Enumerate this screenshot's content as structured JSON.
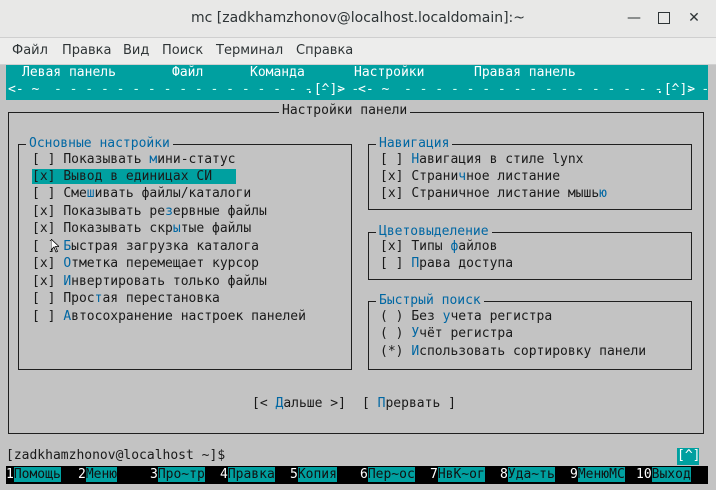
{
  "window": {
    "title": "mc [zadkhamzhonov@localhost.localdomain]:~",
    "minimize": "—",
    "close": "✕"
  },
  "menubar": [
    "Файл",
    "Правка",
    "Вид",
    "Поиск",
    "Терминал",
    "Справка"
  ],
  "mc_menu": [
    "Левая панель",
    "Файл",
    "Команда",
    "Настройки",
    "Правая панель"
  ],
  "panel_bar": {
    "left": "<- ~ ",
    "left_tail": ".[^]>",
    "right": "<- ~ ",
    "right_tail": ".[^]>"
  },
  "dialog": {
    "title": "Настройки панели",
    "main_group": {
      "title": "Основные настройки",
      "items": [
        {
          "mark": "[ ]",
          "pre": "Показывать ",
          "hot": "м",
          "post": "ини-статус"
        },
        {
          "mark": "[x]",
          "pre": "Вывод в единицах СИ",
          "hot": "",
          "post": ""
        },
        {
          "mark": "[ ]",
          "pre": "Сме",
          "hot": "ш",
          "post": "ивать файлы/каталоги"
        },
        {
          "mark": "[x]",
          "pre": "Показывать ре",
          "hot": "з",
          "post": "ервные файлы"
        },
        {
          "mark": "[x]",
          "pre": "Показывать скр",
          "hot": "ы",
          "post": "тые файлы"
        },
        {
          "mark": "[ ]",
          "pre": "",
          "hot": "Б",
          "post": "ыстрая загрузка каталога"
        },
        {
          "mark": "[x]",
          "pre": "",
          "hot": "О",
          "post": "тметка перемещает курсор"
        },
        {
          "mark": "[x]",
          "pre": "",
          "hot": "И",
          "post": "нвертировать только файлы"
        },
        {
          "mark": "[ ]",
          "pre": "Прос",
          "hot": "т",
          "post": "ая перестановка"
        },
        {
          "mark": "[ ]",
          "pre": "",
          "hot": "А",
          "post": "втосохранение настроек панелей"
        }
      ]
    },
    "navigation": {
      "title": "Навигация",
      "items": [
        {
          "mark": "[ ]",
          "pre": "",
          "hot": "Н",
          "post": "авигация в стиле lynx"
        },
        {
          "mark": "[x]",
          "pre": "Страни",
          "hot": "ч",
          "post": "ное листание"
        },
        {
          "mark": "[x]",
          "pre": "Страничное листание мышь",
          "hot": "ю",
          "post": ""
        }
      ]
    },
    "highlight": {
      "title": "Цветовыделение",
      "items": [
        {
          "mark": "[x]",
          "pre": "Типы ",
          "hot": "ф",
          "post": "айлов"
        },
        {
          "mark": "[ ]",
          "pre": "",
          "hot": "П",
          "post": "рава доступа"
        }
      ]
    },
    "quick_search": {
      "title": "Быстрый поиск",
      "items": [
        {
          "mark": "( )",
          "pre": "Без ",
          "hot": "у",
          "post": "чета регистра"
        },
        {
          "mark": "( )",
          "pre": "",
          "hot": "У",
          "post": "чёт регистра"
        },
        {
          "mark": "(*)",
          "pre": "",
          "hot": "И",
          "post": "спользовать сортировку панели"
        }
      ]
    },
    "buttons": {
      "ok_pre": "[< ",
      "ok_hot": "Д",
      "ok_post": "альше >]",
      "cancel_pre": "[ ",
      "cancel_hot": "П",
      "cancel_post": "рервать ]"
    }
  },
  "prompt": "[zadkhamzhonov@localhost ~]$",
  "scroll_button": "[^]",
  "fkeys": [
    {
      "n": "1",
      "l": "Помощь"
    },
    {
      "n": "2",
      "l": "Меню"
    },
    {
      "n": "3",
      "l": "Про~тр"
    },
    {
      "n": "4",
      "l": "Правка"
    },
    {
      "n": "5",
      "l": "Копия"
    },
    {
      "n": "6",
      "l": "Пер~ос"
    },
    {
      "n": "7",
      "l": "НвК~ог"
    },
    {
      "n": "8",
      "l": "Уда~ть"
    },
    {
      "n": "9",
      "l": "МенюМС"
    },
    {
      "n": "10",
      "l": "Выход"
    }
  ]
}
